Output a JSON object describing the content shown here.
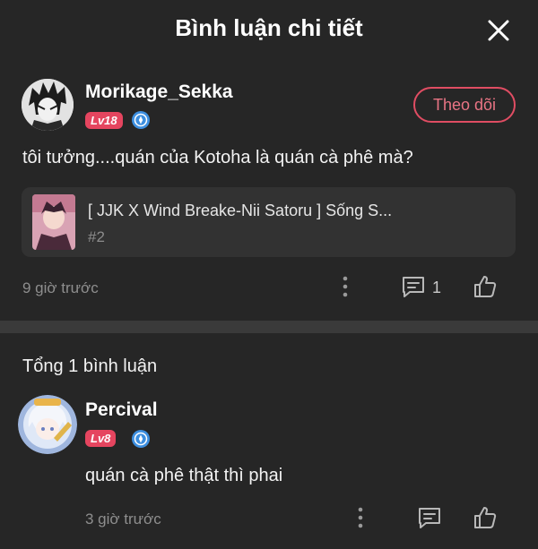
{
  "header": {
    "title": "Bình luận chi tiết"
  },
  "main_comment": {
    "username": "Morikage_Sekka",
    "level": "Lv18",
    "follow_label": "Theo dõi",
    "text": "tôi tưởng....quán của Kotoha là quán cà phê mà?",
    "story": {
      "title": "[ JJK X Wind Breake-Nii Satoru ] Sống S...",
      "chapter": "#2"
    },
    "time": "9 giờ trước",
    "reply_count": "1"
  },
  "replies_section": {
    "total_label": "Tổng 1 bình luận"
  },
  "reply": {
    "username": "Percival",
    "level": "Lv8",
    "text": "quán cà phê thật thì phai",
    "time": "3 giờ trước"
  },
  "colors": {
    "background": "#262626",
    "accent": "#e5455f",
    "verify_blue": "#3d8fe0",
    "muted_text": "#8e8e8e"
  },
  "icons": [
    "close-icon",
    "verified-icon",
    "more-icon",
    "comment-icon",
    "like-icon"
  ]
}
